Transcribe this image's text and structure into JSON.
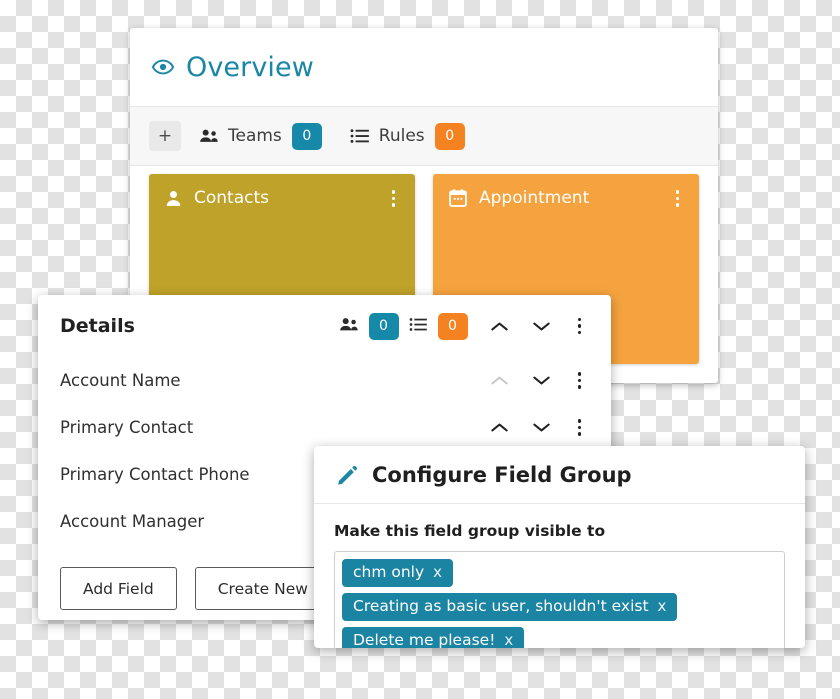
{
  "overview": {
    "title": "Overview",
    "eye_icon": "eye-icon",
    "toolbar": {
      "add_label": "+",
      "items": [
        {
          "icon": "teams-icon",
          "label": "Teams",
          "count": "0",
          "badge_color": "#1789a8"
        },
        {
          "icon": "rules-list-icon",
          "label": "Rules",
          "count": "0",
          "badge_color": "#f58220"
        }
      ]
    },
    "cards": [
      {
        "title": "Contacts",
        "icon": "person-icon",
        "color": "#bfa229",
        "menu_icon": "kebab-menu-icon"
      },
      {
        "title": "Appointment",
        "icon": "calendar-icon",
        "color": "#f5a33e",
        "menu_icon": "kebab-menu-icon"
      }
    ]
  },
  "details": {
    "title": "Details",
    "header_icons": {
      "teams_icon": "teams-icon",
      "teams_count": "0",
      "teams_badge_color": "#1789a8",
      "rules_icon": "rules-list-icon",
      "rules_count": "0",
      "rules_badge_color": "#f58220",
      "move_up_icon": "chevron-up-icon",
      "move_down_icon": "chevron-down-icon",
      "menu_icon": "kebab-menu-icon"
    },
    "fields": [
      {
        "label": "Account Name",
        "up_disabled": true
      },
      {
        "label": "Primary Contact",
        "up_disabled": false
      },
      {
        "label": "Primary Contact Phone",
        "up_disabled": false
      },
      {
        "label": "Account Manager",
        "up_disabled": false
      }
    ],
    "buttons": [
      {
        "label": "Add Field"
      },
      {
        "label": "Create New Field Group"
      }
    ]
  },
  "configure": {
    "title": "Configure Field Group",
    "pencil_icon": "pencil-edit-icon",
    "visibility_label": "Make this field group visible to",
    "chips": [
      {
        "label": "chm only",
        "remove": "x"
      },
      {
        "label": "Creating as basic user, shouldn't exist",
        "remove": "x"
      },
      {
        "label": "Delete me please!",
        "remove": "x"
      }
    ],
    "chip_color": "#1b84a3"
  }
}
